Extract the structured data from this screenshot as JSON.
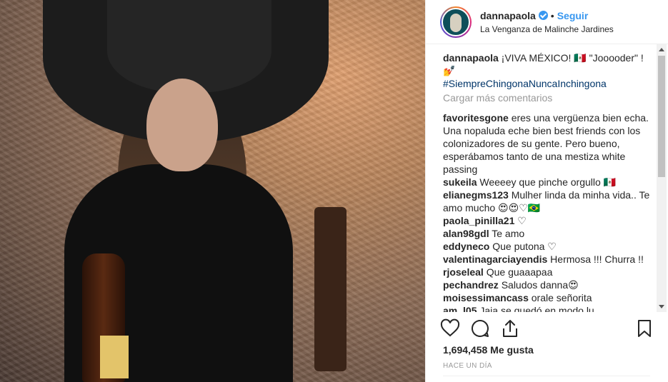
{
  "post": {
    "username": "dannapaola",
    "dot": "•",
    "follow_label": "Seguir",
    "location": "La Venganza de Malinche Jardines"
  },
  "caption": {
    "user": "dannapaola",
    "text": " ¡VIVA MÉXICO! 🇲🇽 \"Jooooder\" ! 💅",
    "hashtag": "#SiempreChingonaNuncaInchingona"
  },
  "load_more": "Cargar más comentarios",
  "comments": [
    {
      "user": "favoritesgone",
      "text": " eres una vergüenza bien echa. Una nopaluda eche bien best friends con los colonizadores de su gente. Pero bueno, esperábamos tanto de una mestiza white passing"
    },
    {
      "user": "sukeila",
      "text": " Weeeey que pinche orgullo 🇲🇽"
    },
    {
      "user": "elianegms123",
      "text": " Mulher linda da minha vida.. Te amo mucho 😍😍♡🇧🇷"
    },
    {
      "user": "paola_pinilla21",
      "text": " ♡"
    },
    {
      "user": "alan98gdl",
      "text": " Te amo"
    },
    {
      "user": "eddyneco",
      "text": " Que putona ♡"
    },
    {
      "user": "valentinagarciayendis",
      "text": " Hermosa !!! Churra !!"
    },
    {
      "user": "rjoseleal",
      "text": " Que guaaapaa"
    },
    {
      "user": "pechandrez",
      "text": " Saludos danna😍"
    },
    {
      "user": "moisessimancass",
      "text": " orale señorita"
    },
    {
      "user": "am_l05",
      "text": " Jaja se quedó en modo lu..."
    }
  ],
  "likes": "1,694,458 Me gusta",
  "timestamp": "HACE UN DÍA",
  "icons": {
    "like": "heart-icon",
    "comment": "comment-icon",
    "share": "share-icon",
    "save": "bookmark-icon",
    "verified": "verified-badge-icon"
  },
  "colors": {
    "link": "#3897f0",
    "hashtag": "#003569",
    "muted": "#999999",
    "text": "#262626"
  }
}
